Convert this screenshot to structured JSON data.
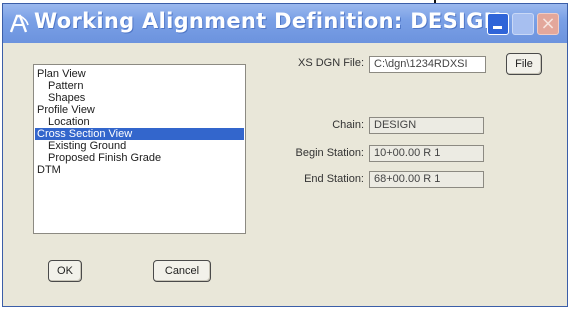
{
  "window": {
    "title": "Working Alignment Definition: DESIGN",
    "title_color": "#ffffff",
    "titlebar_color": "#7aa0e6"
  },
  "tree": {
    "selected_color": "#3366cc",
    "items": [
      {
        "label": "Plan View",
        "level": 0,
        "selected": false
      },
      {
        "label": "Pattern",
        "level": 1,
        "selected": false
      },
      {
        "label": "Shapes",
        "level": 1,
        "selected": false
      },
      {
        "label": "Profile View",
        "level": 0,
        "selected": false
      },
      {
        "label": "Location",
        "level": 1,
        "selected": false
      },
      {
        "label": "Cross Section View",
        "level": 0,
        "selected": true
      },
      {
        "label": "Existing Ground",
        "level": 1,
        "selected": false
      },
      {
        "label": "Proposed Finish Grade",
        "level": 1,
        "selected": false
      },
      {
        "label": "DTM",
        "level": 0,
        "selected": false
      }
    ]
  },
  "fields": {
    "xs_dgn_file": {
      "label": "XS DGN File:",
      "value": "C:\\dgn\\1234RDXSI"
    },
    "chain": {
      "label": "Chain:",
      "value": "DESIGN"
    },
    "begin_station": {
      "label": "Begin Station:",
      "value": "10+00.00 R 1"
    },
    "end_station": {
      "label": "End Station:",
      "value": "68+00.00 R 1"
    }
  },
  "buttons": {
    "file": "File",
    "ok": "OK",
    "cancel": "Cancel"
  }
}
